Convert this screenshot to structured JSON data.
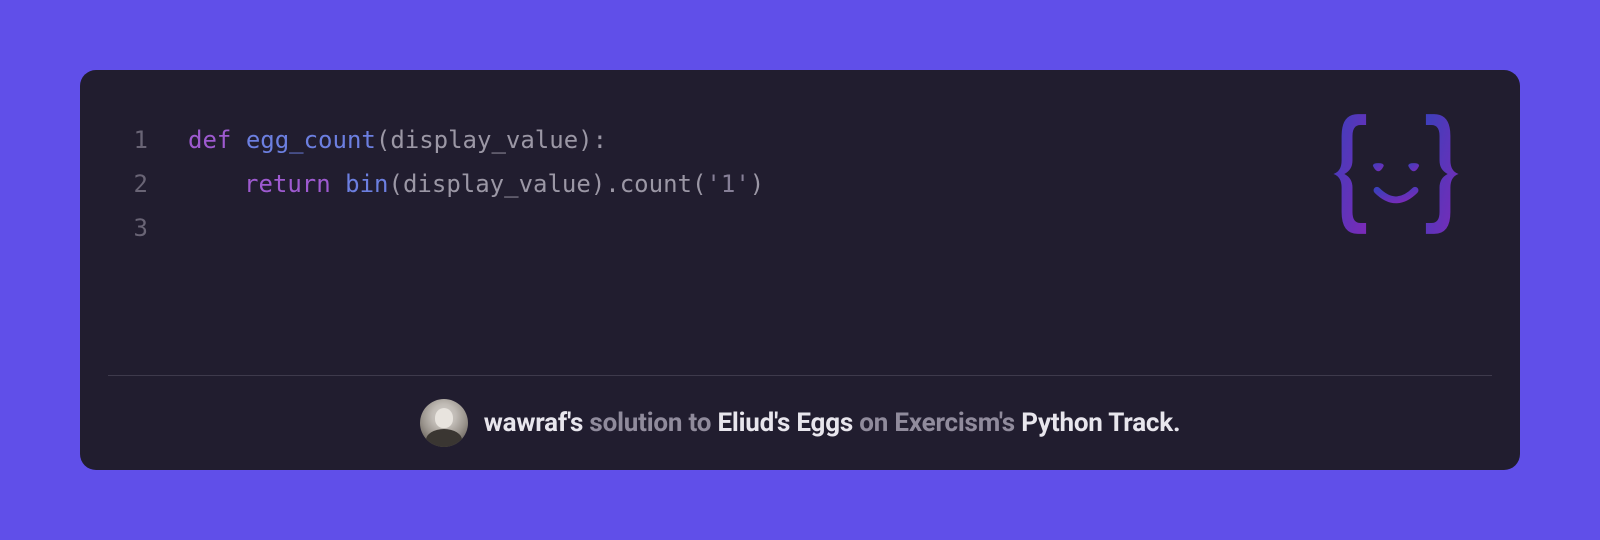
{
  "code": {
    "lines": [
      {
        "n": "1"
      },
      {
        "n": "2"
      },
      {
        "n": "3"
      }
    ],
    "line1": {
      "def": "def",
      "func": "egg_count",
      "lp": "(",
      "param": "display_value",
      "rp": "):"
    },
    "line2": {
      "return": "return",
      "bin": "bin",
      "lp": "(",
      "arg": "display_value",
      "rp": ")",
      "dot": ".",
      "count": "count",
      "lp2": "(",
      "str": "'1'",
      "rp2": ")"
    }
  },
  "footer": {
    "user": "wawraf's",
    "t1": " solution to ",
    "exercise": "Eliud's Eggs",
    "t2": " on Exercism's ",
    "track": "Python Track."
  }
}
